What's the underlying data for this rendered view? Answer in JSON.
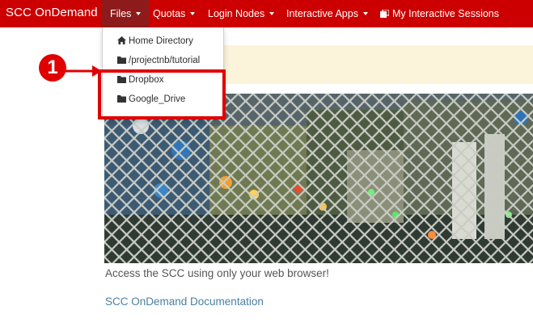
{
  "navbar": {
    "brand": "SCC OnDemand",
    "items": [
      {
        "label": "Files",
        "active": true
      },
      {
        "label": "Quotas"
      },
      {
        "label": "Login Nodes"
      },
      {
        "label": "Interactive Apps"
      },
      {
        "label": "My Interactive Sessions",
        "icon": "sessions-icon"
      }
    ]
  },
  "files_menu": {
    "items": [
      {
        "label": "Home Directory",
        "icon": "home-icon"
      },
      {
        "label": "/projectnb/tutorial",
        "icon": "folder-icon"
      },
      {
        "label": "Dropbox",
        "icon": "folder-icon"
      },
      {
        "label": "Google_Drive",
        "icon": "folder-icon"
      }
    ]
  },
  "annotation": {
    "number": "1",
    "color": "#e00000"
  },
  "main": {
    "description": "Access the SCC using only your web browser!",
    "doc_link": "SCC OnDemand Documentation"
  },
  "colors": {
    "navbar_bg": "#cc0000",
    "active_tab_bg": "#8e1b1b",
    "alert_bg": "#fcf4da",
    "link": "#4a7fa0"
  }
}
